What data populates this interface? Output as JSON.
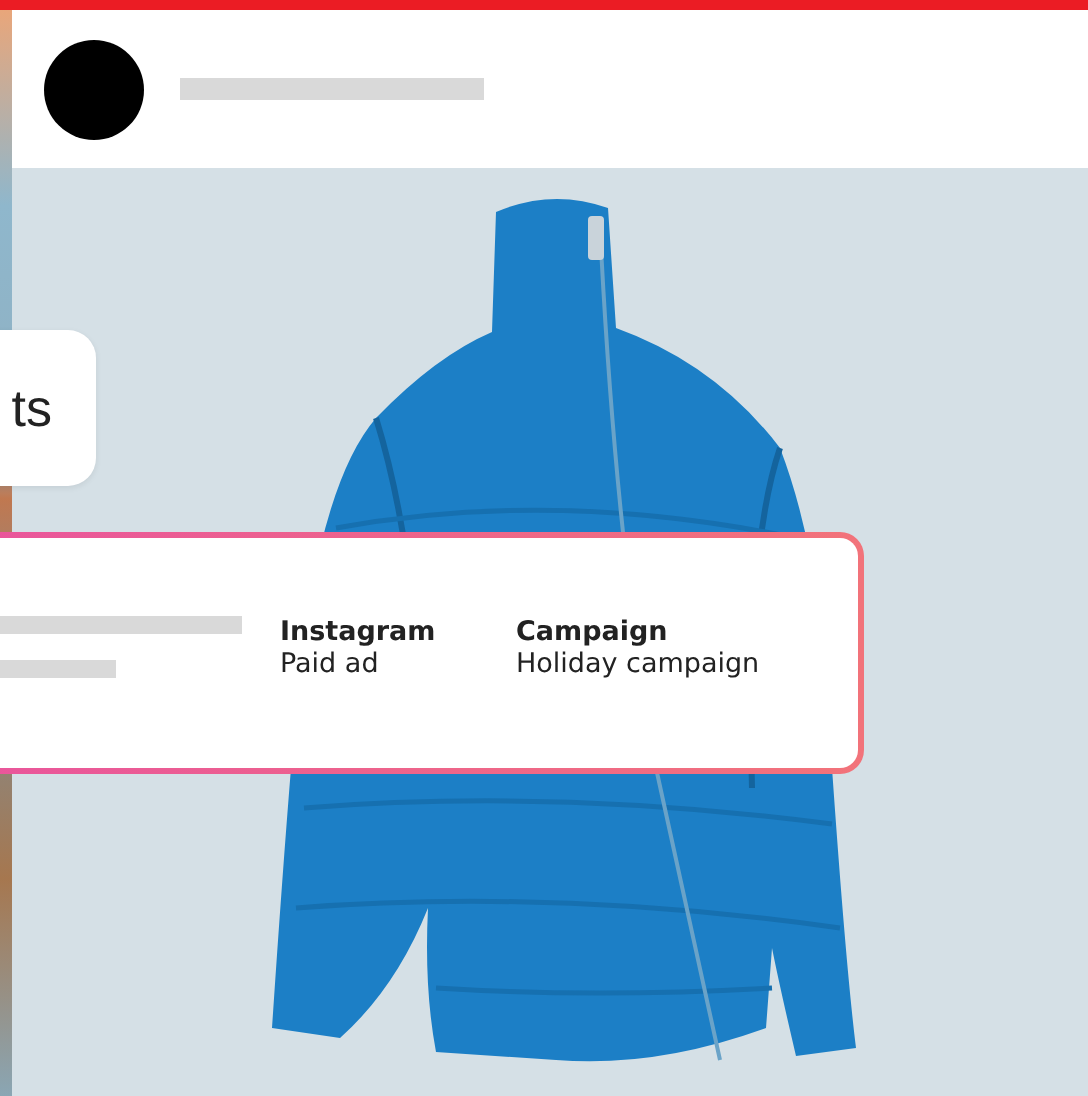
{
  "chip": {
    "text": "ts"
  },
  "info_card": {
    "fields": [
      {
        "label": "Instagram",
        "value": "Paid ad"
      },
      {
        "label": "Campaign",
        "value": "Holiday campaign"
      }
    ]
  }
}
